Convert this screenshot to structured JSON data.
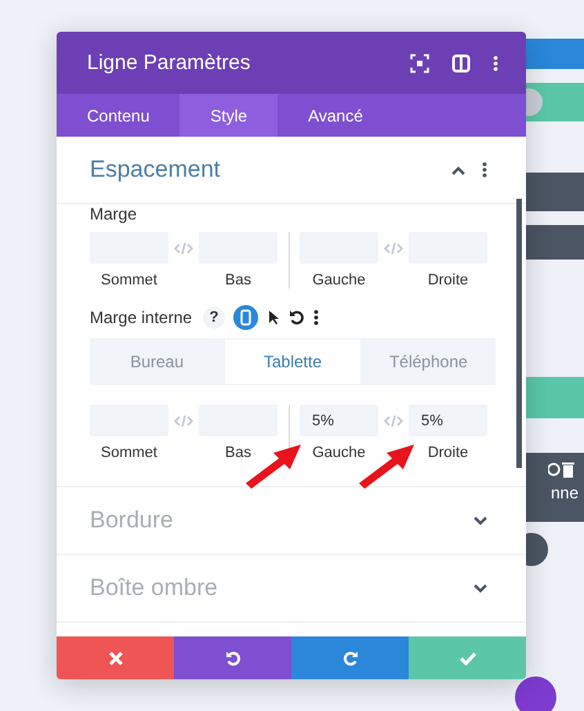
{
  "window": {
    "title": "Ligne Paramètres"
  },
  "tabs": [
    {
      "label": "Contenu",
      "selected": false
    },
    {
      "label": "Style",
      "selected": true
    },
    {
      "label": "Avancé",
      "selected": false
    }
  ],
  "sections": [
    {
      "title": "Espacement",
      "expanded": true,
      "margin": {
        "label": "Marge",
        "fields": [
          {
            "label": "Sommet"
          },
          {
            "label": "Bas"
          },
          {
            "label": "Gauche"
          },
          {
            "label": "Droite"
          }
        ]
      },
      "padding": {
        "label": "Marge interne",
        "help": "?",
        "devices": [
          {
            "label": "Bureau",
            "selected": false
          },
          {
            "label": "Tablette",
            "selected": true
          },
          {
            "label": "Téléphone",
            "selected": false
          }
        ],
        "fields": [
          {
            "label": "Sommet"
          },
          {
            "label": "Bas"
          },
          {
            "label": "Gauche",
            "value": "5%"
          },
          {
            "label": "Droite",
            "value": "5%"
          }
        ]
      }
    },
    {
      "title": "Bordure",
      "expanded": false
    },
    {
      "title": "Boîte ombre",
      "expanded": false
    }
  ],
  "background": {
    "module_label": "nne"
  }
}
